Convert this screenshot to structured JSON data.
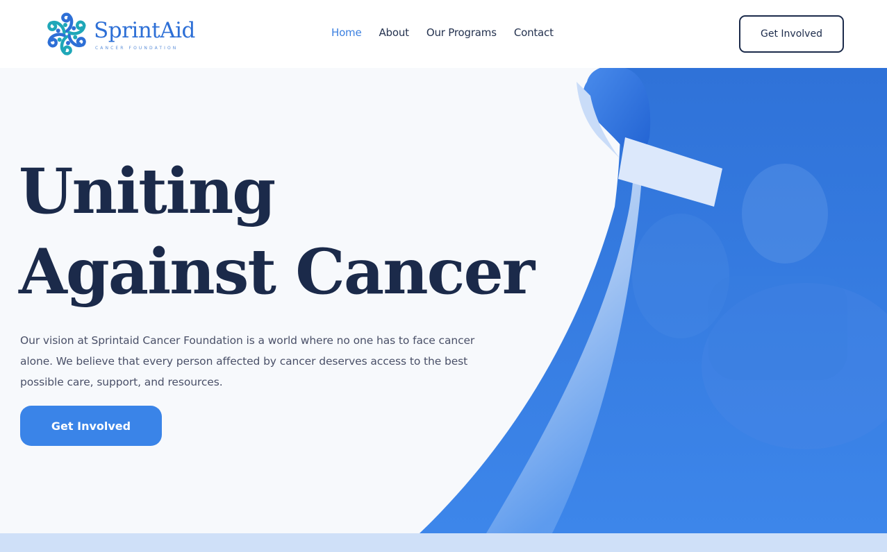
{
  "brand": {
    "name": "SprintAid",
    "tagline": "CANCER FOUNDATION",
    "colors": {
      "primary": "#3a84e8",
      "navy": "#1b2a4a",
      "teal": "#1fa7b8"
    }
  },
  "nav": {
    "items": [
      {
        "label": "Home",
        "active": true
      },
      {
        "label": "About",
        "active": false
      },
      {
        "label": "Our Programs",
        "active": false
      },
      {
        "label": "Contact",
        "active": false
      }
    ]
  },
  "header": {
    "cta_label": "Get Involved"
  },
  "hero": {
    "title_line1": "Uniting",
    "title_line2": "Against Cancer",
    "description": "Our vision at Sprintaid Cancer Foundation is a world where no one has to face cancer alone. We believe that every person affected by cancer deserves access to the best possible care, support, and resources.",
    "cta_label": "Get Involved",
    "image_icon": "awareness-ribbon-photo"
  }
}
